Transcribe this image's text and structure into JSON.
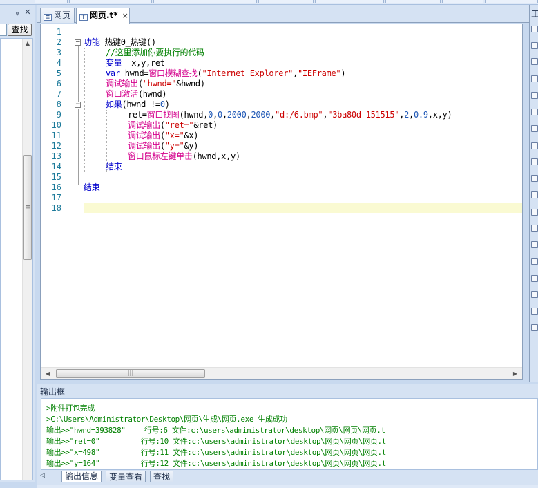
{
  "left_panel": {
    "pin": "ᵩ",
    "close": "✕",
    "find_button": "查找"
  },
  "tabs": [
    {
      "label": "网页",
      "active": false
    },
    {
      "label": "网页.t*",
      "active": true
    }
  ],
  "tab_close": "×",
  "tab_menu": "▼",
  "right_panel_title": "工",
  "editor": {
    "line_numbers": [
      "1",
      "2",
      "3",
      "4",
      "5",
      "6",
      "7",
      "8",
      "9",
      "10",
      "11",
      "12",
      "13",
      "14",
      "15",
      "16",
      "17",
      "18"
    ]
  },
  "output": {
    "title": "输出框",
    "lines": [
      {
        "text": ">附件打包完成"
      },
      {
        "text": ">C:\\Users\\Administrator\\Desktop\\网页\\生成\\网页.exe 生成成功"
      },
      {
        "left": "输出>>\"hwnd=393828\"",
        "right": "行号:6 文件:c:\\users\\administrator\\desktop\\网页\\网页\\网页.t"
      },
      {
        "left": "输出>>\"ret=0\"",
        "right": "行号:10 文件:c:\\users\\administrator\\desktop\\网页\\网页\\网页.t"
      },
      {
        "left": "输出>>\"x=498\"",
        "right": "行号:11 文件:c:\\users\\administrator\\desktop\\网页\\网页\\网页.t"
      },
      {
        "left": "输出>>\"y=164\"",
        "right": "行号:12 文件:c:\\users\\administrator\\desktop\\网页\\网页\\网页.t"
      }
    ],
    "tabs": [
      "输出信息",
      "变量查看",
      "查找"
    ]
  },
  "code": {
    "l2": {
      "kw": "功能",
      "rest": " 热键0_热键()"
    },
    "l3": {
      "comment": "//这里添加你要执行的代码"
    },
    "l4": {
      "kw": "变量",
      "rest": "  x,y,ret"
    },
    "l5": {
      "kw": "var",
      "a": " hwnd=",
      "fn": "窗口模糊查找",
      "p1": "(",
      "s1": "\"Internet Explorer\"",
      "c": ",",
      "s2": "\"IEFrame\"",
      "p2": ")"
    },
    "l6": {
      "fn": "调试输出",
      "p1": "(",
      "s1": "\"hwnd=\"",
      "rest": "&hwnd)"
    },
    "l7": {
      "fn": "窗口激活",
      "rest": "(hwnd)"
    },
    "l8": {
      "kw": "如果",
      "a": "(hwnd !=",
      "n": "0",
      "b": ")"
    },
    "l9": {
      "a": "ret=",
      "fn": "窗口找图",
      "b": "(hwnd,",
      "n1": "0",
      "c1": ",",
      "n2": "0",
      "c2": ",",
      "n3": "2000",
      "c3": ",",
      "n4": "2000",
      "c4": ",",
      "s1": "\"d:/6.bmp\"",
      "c5": ",",
      "s2": "\"3ba80d-151515\"",
      "c6": ",",
      "n5": "2",
      "c7": ",",
      "n6": "0.9",
      "d": ",x,y)"
    },
    "l10": {
      "fn": "调试输出",
      "p1": "(",
      "s1": "\"ret=\"",
      "rest": "&ret)"
    },
    "l11": {
      "fn": "调试输出",
      "p1": "(",
      "s1": "\"x=\"",
      "rest": "&x)"
    },
    "l12": {
      "fn": "调试输出",
      "p1": "(",
      "s1": "\"y=\"",
      "rest": "&y)"
    },
    "l13": {
      "fn": "窗口鼠标左键单击",
      "rest": "(hwnd,x,y)"
    },
    "l14": {
      "kw": "结束"
    },
    "l16": {
      "kw": "结束"
    }
  },
  "colors": {
    "keyword": "#0000cc",
    "comment": "#008000",
    "function": "#d4008c",
    "string": "#cc0000",
    "number": "#1e57b5",
    "current_line": "#fafad2"
  }
}
